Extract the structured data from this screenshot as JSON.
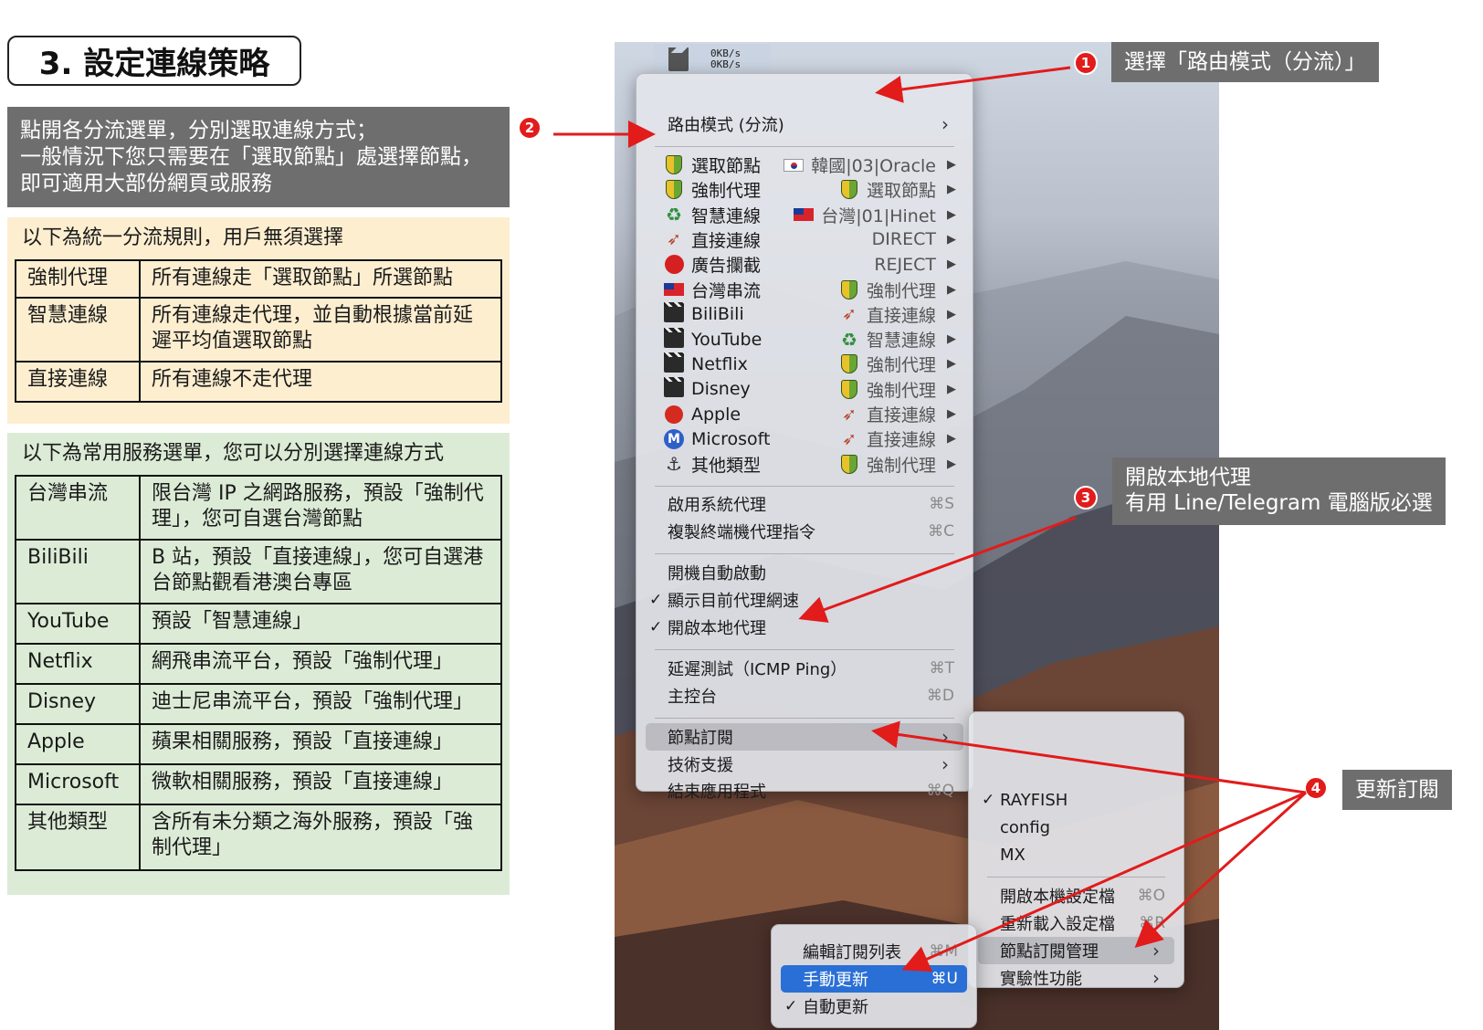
{
  "title": "3. 設定連線策略",
  "intro": {
    "line1": "點開各分流選單，分別選取連線方式；",
    "line2": "一般情況下您只需要在「選取節點」處選擇節點，",
    "line3": "即可適用大部份網頁或服務"
  },
  "rules": {
    "heading": "以下為統一分流規則，用戶無須選擇",
    "rows": [
      {
        "name": "強制代理",
        "desc": "所有連線走「選取節點」所選節點"
      },
      {
        "name": "智慧連線",
        "desc": "所有連線走代理，並自動根據當前延遲平均值選取節點"
      },
      {
        "name": "直接連線",
        "desc": "所有連線不走代理"
      }
    ]
  },
  "services": {
    "heading": "以下為常用服務選單，您可以分別選擇連線方式",
    "rows": [
      {
        "name": "台灣串流",
        "desc": "限台灣 IP 之網路服務，預設「強制代理」，您可自選台灣節點"
      },
      {
        "name": "BiliBili",
        "desc": "B 站，預設「直接連線」，您可自選港台節點觀看港澳台專區"
      },
      {
        "name": "YouTube",
        "desc": "預設「智慧連線」"
      },
      {
        "name": "Netflix",
        "desc": "網飛串流平台，預設「強制代理」"
      },
      {
        "name": "Disney",
        "desc": "迪士尼串流平台，預設「強制代理」"
      },
      {
        "name": "Apple",
        "desc": "蘋果相關服務，預設「直接連線」"
      },
      {
        "name": "Microsoft",
        "desc": "微軟相關服務，預設「直接連線」"
      },
      {
        "name": "其他類型",
        "desc": "含所有未分類之海外服務，預設「強制代理」"
      }
    ]
  },
  "statusbar": {
    "up": "0KB/s",
    "down": "0KB/s"
  },
  "menu": {
    "route_mode": "路由模式 (分流)",
    "proxies": [
      {
        "icon": "shield-icon",
        "name": "選取節點",
        "val_icon": "flag-kr-icon",
        "value": "韓國|03|Oracle"
      },
      {
        "icon": "shield-icon",
        "name": "強制代理",
        "val_icon": "shield-icon",
        "value": "選取節點"
      },
      {
        "icon": "recycle-icon",
        "name": "智慧連線",
        "val_icon": "flag-tw-icon",
        "value": "台灣|01|Hinet"
      },
      {
        "icon": "rocket-icon",
        "name": "直接連線",
        "val_icon": "",
        "value": "DIRECT"
      },
      {
        "icon": "stop-icon",
        "name": "廣告攔截",
        "val_icon": "",
        "value": "REJECT"
      },
      {
        "icon": "flag-tw-icon",
        "name": "台灣串流",
        "val_icon": "shield-icon",
        "value": "強制代理"
      },
      {
        "icon": "clapper-icon",
        "name": "BiliBili",
        "val_icon": "rocket-icon",
        "value": "直接連線"
      },
      {
        "icon": "clapper-icon",
        "name": "YouTube",
        "val_icon": "recycle-icon",
        "value": "智慧連線"
      },
      {
        "icon": "clapper-icon",
        "name": "Netflix",
        "val_icon": "shield-icon",
        "value": "強制代理"
      },
      {
        "icon": "clapper-icon",
        "name": "Disney",
        "val_icon": "shield-icon",
        "value": "強制代理"
      },
      {
        "icon": "apple-icon",
        "name": "Apple",
        "val_icon": "rocket-icon",
        "value": "直接連線"
      },
      {
        "icon": "m-icon",
        "name": "Microsoft",
        "val_icon": "rocket-icon",
        "value": "直接連線"
      },
      {
        "icon": "anchor-icon",
        "name": "其他類型",
        "val_icon": "shield-icon",
        "value": "強制代理"
      }
    ],
    "system_proxy": "啟用系統代理",
    "system_proxy_sc": "⌘S",
    "copy_cmd": "複製終端機代理指令",
    "copy_cmd_sc": "⌘C",
    "autostart": "開機自動啟動",
    "show_speed": "顯示目前代理網速",
    "local_proxy": "開啟本地代理",
    "latency": "延遲測試（ICMP Ping）",
    "latency_sc": "⌘T",
    "dashboard": "主控台",
    "dashboard_sc": "⌘D",
    "subscription": "節點訂閱",
    "support": "技術支援",
    "quit": "結束應用程式",
    "quit_sc": "⌘Q"
  },
  "submenu": {
    "configs": [
      "RAYFISH",
      "config",
      "MX"
    ],
    "open_config": "開啟本機設定檔",
    "open_config_sc": "⌘O",
    "reload_config": "重新載入設定檔",
    "reload_config_sc": "⌘R",
    "sub_manage": "節點訂閱管理",
    "experimental": "實驗性功能"
  },
  "subsubmenu": {
    "edit_list": "編輯訂閱列表",
    "edit_list_sc": "⌘M",
    "manual_update": "手動更新",
    "manual_update_sc": "⌘U",
    "auto_update": "自動更新"
  },
  "callouts": {
    "c1": {
      "num": "1",
      "text": "選擇「路由模式（分流）」"
    },
    "c2": {
      "num": "2"
    },
    "c3": {
      "num": "3",
      "line1": "開啟本地代理",
      "line2": "有用 Line/Telegram 電腦版必選"
    },
    "c4": {
      "num": "4",
      "text": "更新訂閱"
    }
  },
  "colors": {
    "arrow": "#e21b1b",
    "callout_bg": "#6e6e6e",
    "rules_bg": "#fdeed0",
    "services_bg": "#dcebd6",
    "highlight": "#2a6fd6"
  }
}
